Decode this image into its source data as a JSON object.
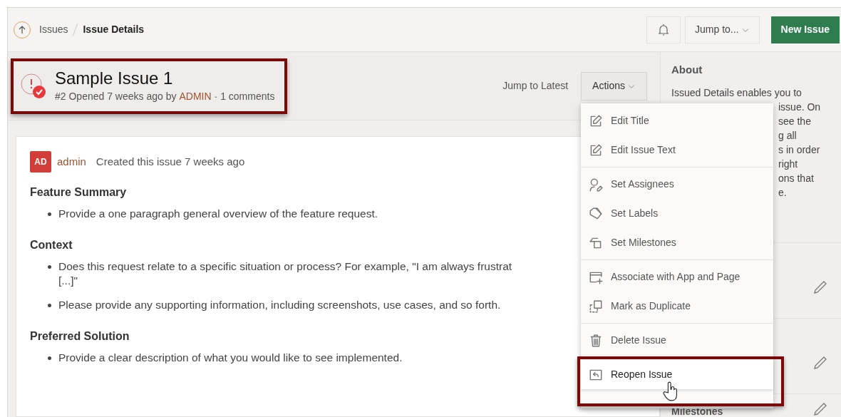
{
  "breadcrumb": [
    {
      "label": "Issues",
      "kind": "link"
    },
    {
      "label": "Issue Details",
      "kind": "current"
    }
  ],
  "header_buttons": {
    "jump_to": "Jump to...",
    "new_issue": "New Issue"
  },
  "issue": {
    "title": "Sample Issue 1",
    "meta_prefix": "#2 Opened 7 weeks ago by",
    "author": "ADMIN",
    "meta_suffix": "· 1 comments",
    "highlighted": true
  },
  "toolbar": {
    "jump_latest": "Jump to Latest",
    "actions": "Actions"
  },
  "actions_menu": [
    [
      {
        "label": "Edit Title",
        "highlighted": false
      },
      {
        "label": "Edit Issue Text",
        "highlighted": false
      }
    ],
    [
      {
        "label": "Set Assignees",
        "highlighted": false
      },
      {
        "label": "Set Labels",
        "highlighted": false
      },
      {
        "label": "Set Milestones",
        "highlighted": false
      }
    ],
    [
      {
        "label": "Associate with App and Page",
        "highlighted": false
      },
      {
        "label": "Mark as Duplicate",
        "highlighted": false
      }
    ],
    [
      {
        "label": "Delete Issue",
        "highlighted": false
      }
    ],
    [
      {
        "label": "Reopen Issue",
        "highlighted": true
      }
    ]
  ],
  "comment": {
    "avatar": "AD",
    "author": "admin",
    "action": "Created this issue 7 weeks ago",
    "sections": [
      {
        "heading": "Feature Summary",
        "bullets": [
          [
            "Provide a one paragraph general overview of the feature request."
          ]
        ]
      },
      {
        "heading": "Context",
        "bullets": [
          [
            "Does this request relate to a specific situation or process? For example, \"I am always frustrat",
            "[...]\""
          ],
          [
            "Please provide any supporting information, including screenshots, use cases, and so forth."
          ]
        ]
      },
      {
        "heading": "Preferred Solution",
        "bullets": [
          [
            "Provide a clear description of what you would like to see implemented."
          ]
        ]
      }
    ]
  },
  "sidebar": {
    "about_title": "About",
    "about_lines": [
      "Issued Details enables you to",
      "issue. On",
      "see the",
      "g all",
      "s in order",
      "right",
      "ons that",
      "e."
    ],
    "bottom_label": "Milestones"
  }
}
